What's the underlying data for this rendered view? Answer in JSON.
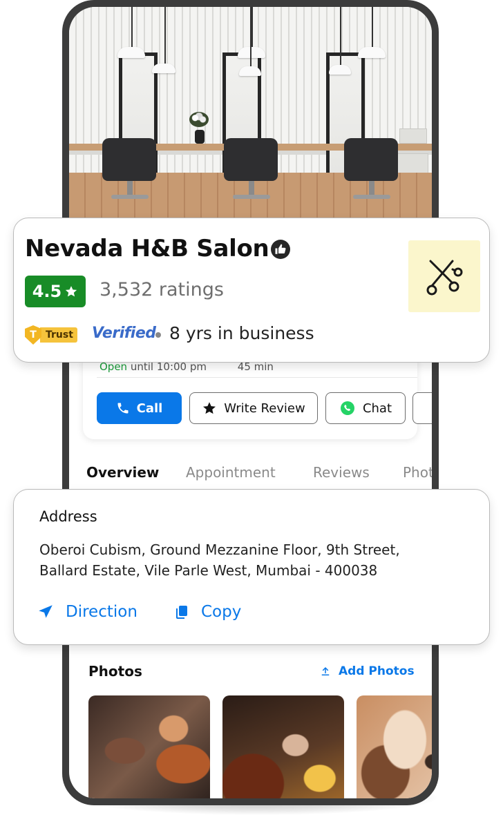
{
  "business": {
    "name": "Nevada H&B Salon",
    "rating": "4.5",
    "ratings_count": "3,532 ratings",
    "trust_label": "Trust",
    "verified_label": "Verified",
    "years_in_business": "8 yrs in business"
  },
  "hours": {
    "status": "Open",
    "until": "until 10:00 pm",
    "eta": "45 min"
  },
  "actions": {
    "call": "Call",
    "write_review": "Write Review",
    "chat": "Chat"
  },
  "tabs": [
    {
      "label": "Overview",
      "active": true
    },
    {
      "label": "Appointment",
      "active": false
    },
    {
      "label": "Reviews",
      "active": false
    },
    {
      "label": "Photos",
      "active": false
    }
  ],
  "address": {
    "title": "Address",
    "line1": "Oberoi Cubism, Ground Mezzanine Floor, 9th Street,",
    "line2": "Ballard Estate, Vile Parle West, Mumbai - 400038",
    "direction": "Direction",
    "copy": "Copy"
  },
  "photos": {
    "title": "Photos",
    "add_label": "Add Photos"
  },
  "colors": {
    "accent_blue": "#0a78e8",
    "rating_green": "#188c27",
    "trust_yellow": "#f5c33c",
    "verified_blue": "#3a6bc9",
    "phone_frame": "#3c3c3c"
  },
  "icons": [
    "thumbs-up-icon",
    "star-icon",
    "phone-icon",
    "whatsapp-icon",
    "navigation-arrow-icon",
    "copy-icon",
    "upload-icon",
    "scissors-logo-icon",
    "trust-shield-icon"
  ]
}
